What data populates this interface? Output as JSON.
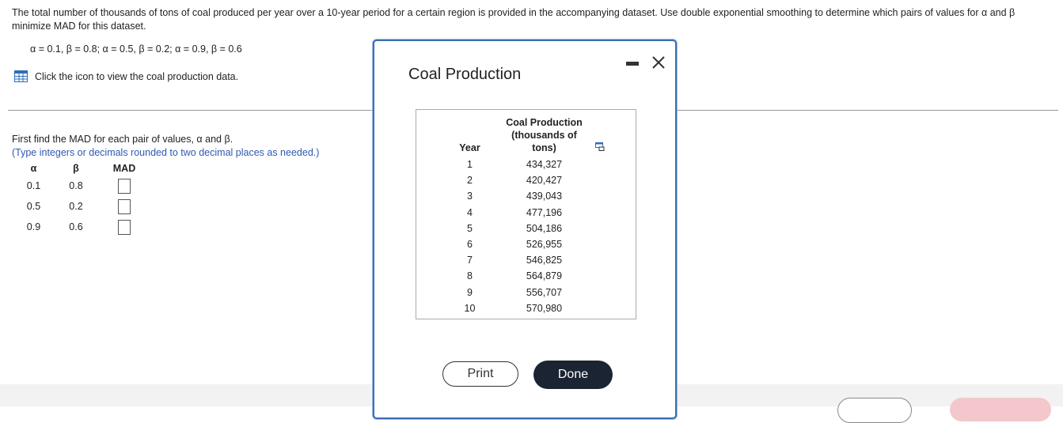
{
  "question": {
    "text": "The total number of thousands of tons of coal produced per year over a 10-year period for a certain region is provided in the accompanying dataset. Use double exponential smoothing to determine which pairs of values for α and β minimize MAD for this dataset.",
    "params": "α = 0.1, β = 0.8; α = 0.5, β = 0.2; α = 0.9, β = 0.6"
  },
  "data_link": {
    "icon": "grid-table-icon",
    "label": "Click the icon to view the coal production data."
  },
  "instructions": {
    "line1": "First find the MAD for each pair of values, α and β.",
    "hint": "(Type integers or decimals rounded to two decimal places as needed.)"
  },
  "answer_table": {
    "headers": {
      "alpha": "α",
      "beta": "β",
      "mad": "MAD"
    },
    "rows": [
      {
        "alpha": "0.1",
        "beta": "0.8",
        "mad": ""
      },
      {
        "alpha": "0.5",
        "beta": "0.2",
        "mad": ""
      },
      {
        "alpha": "0.9",
        "beta": "0.6",
        "mad": ""
      }
    ]
  },
  "modal": {
    "title": "Coal Production",
    "table": {
      "headers": {
        "year": "Year",
        "production": "Coal Production (thousands of tons)"
      },
      "rows": [
        {
          "year": "1",
          "production": "434,327"
        },
        {
          "year": "2",
          "production": "420,427"
        },
        {
          "year": "3",
          "production": "439,043"
        },
        {
          "year": "4",
          "production": "477,196"
        },
        {
          "year": "5",
          "production": "504,186"
        },
        {
          "year": "6",
          "production": "526,955"
        },
        {
          "year": "7",
          "production": "546,825"
        },
        {
          "year": "8",
          "production": "564,879"
        },
        {
          "year": "9",
          "production": "556,707"
        },
        {
          "year": "10",
          "production": "570,980"
        }
      ]
    },
    "print_label": "Print",
    "done_label": "Done"
  },
  "colors": {
    "hint": "#2f58b4",
    "modal_border": "#3c6fb1",
    "done_bg": "#1b2432"
  }
}
